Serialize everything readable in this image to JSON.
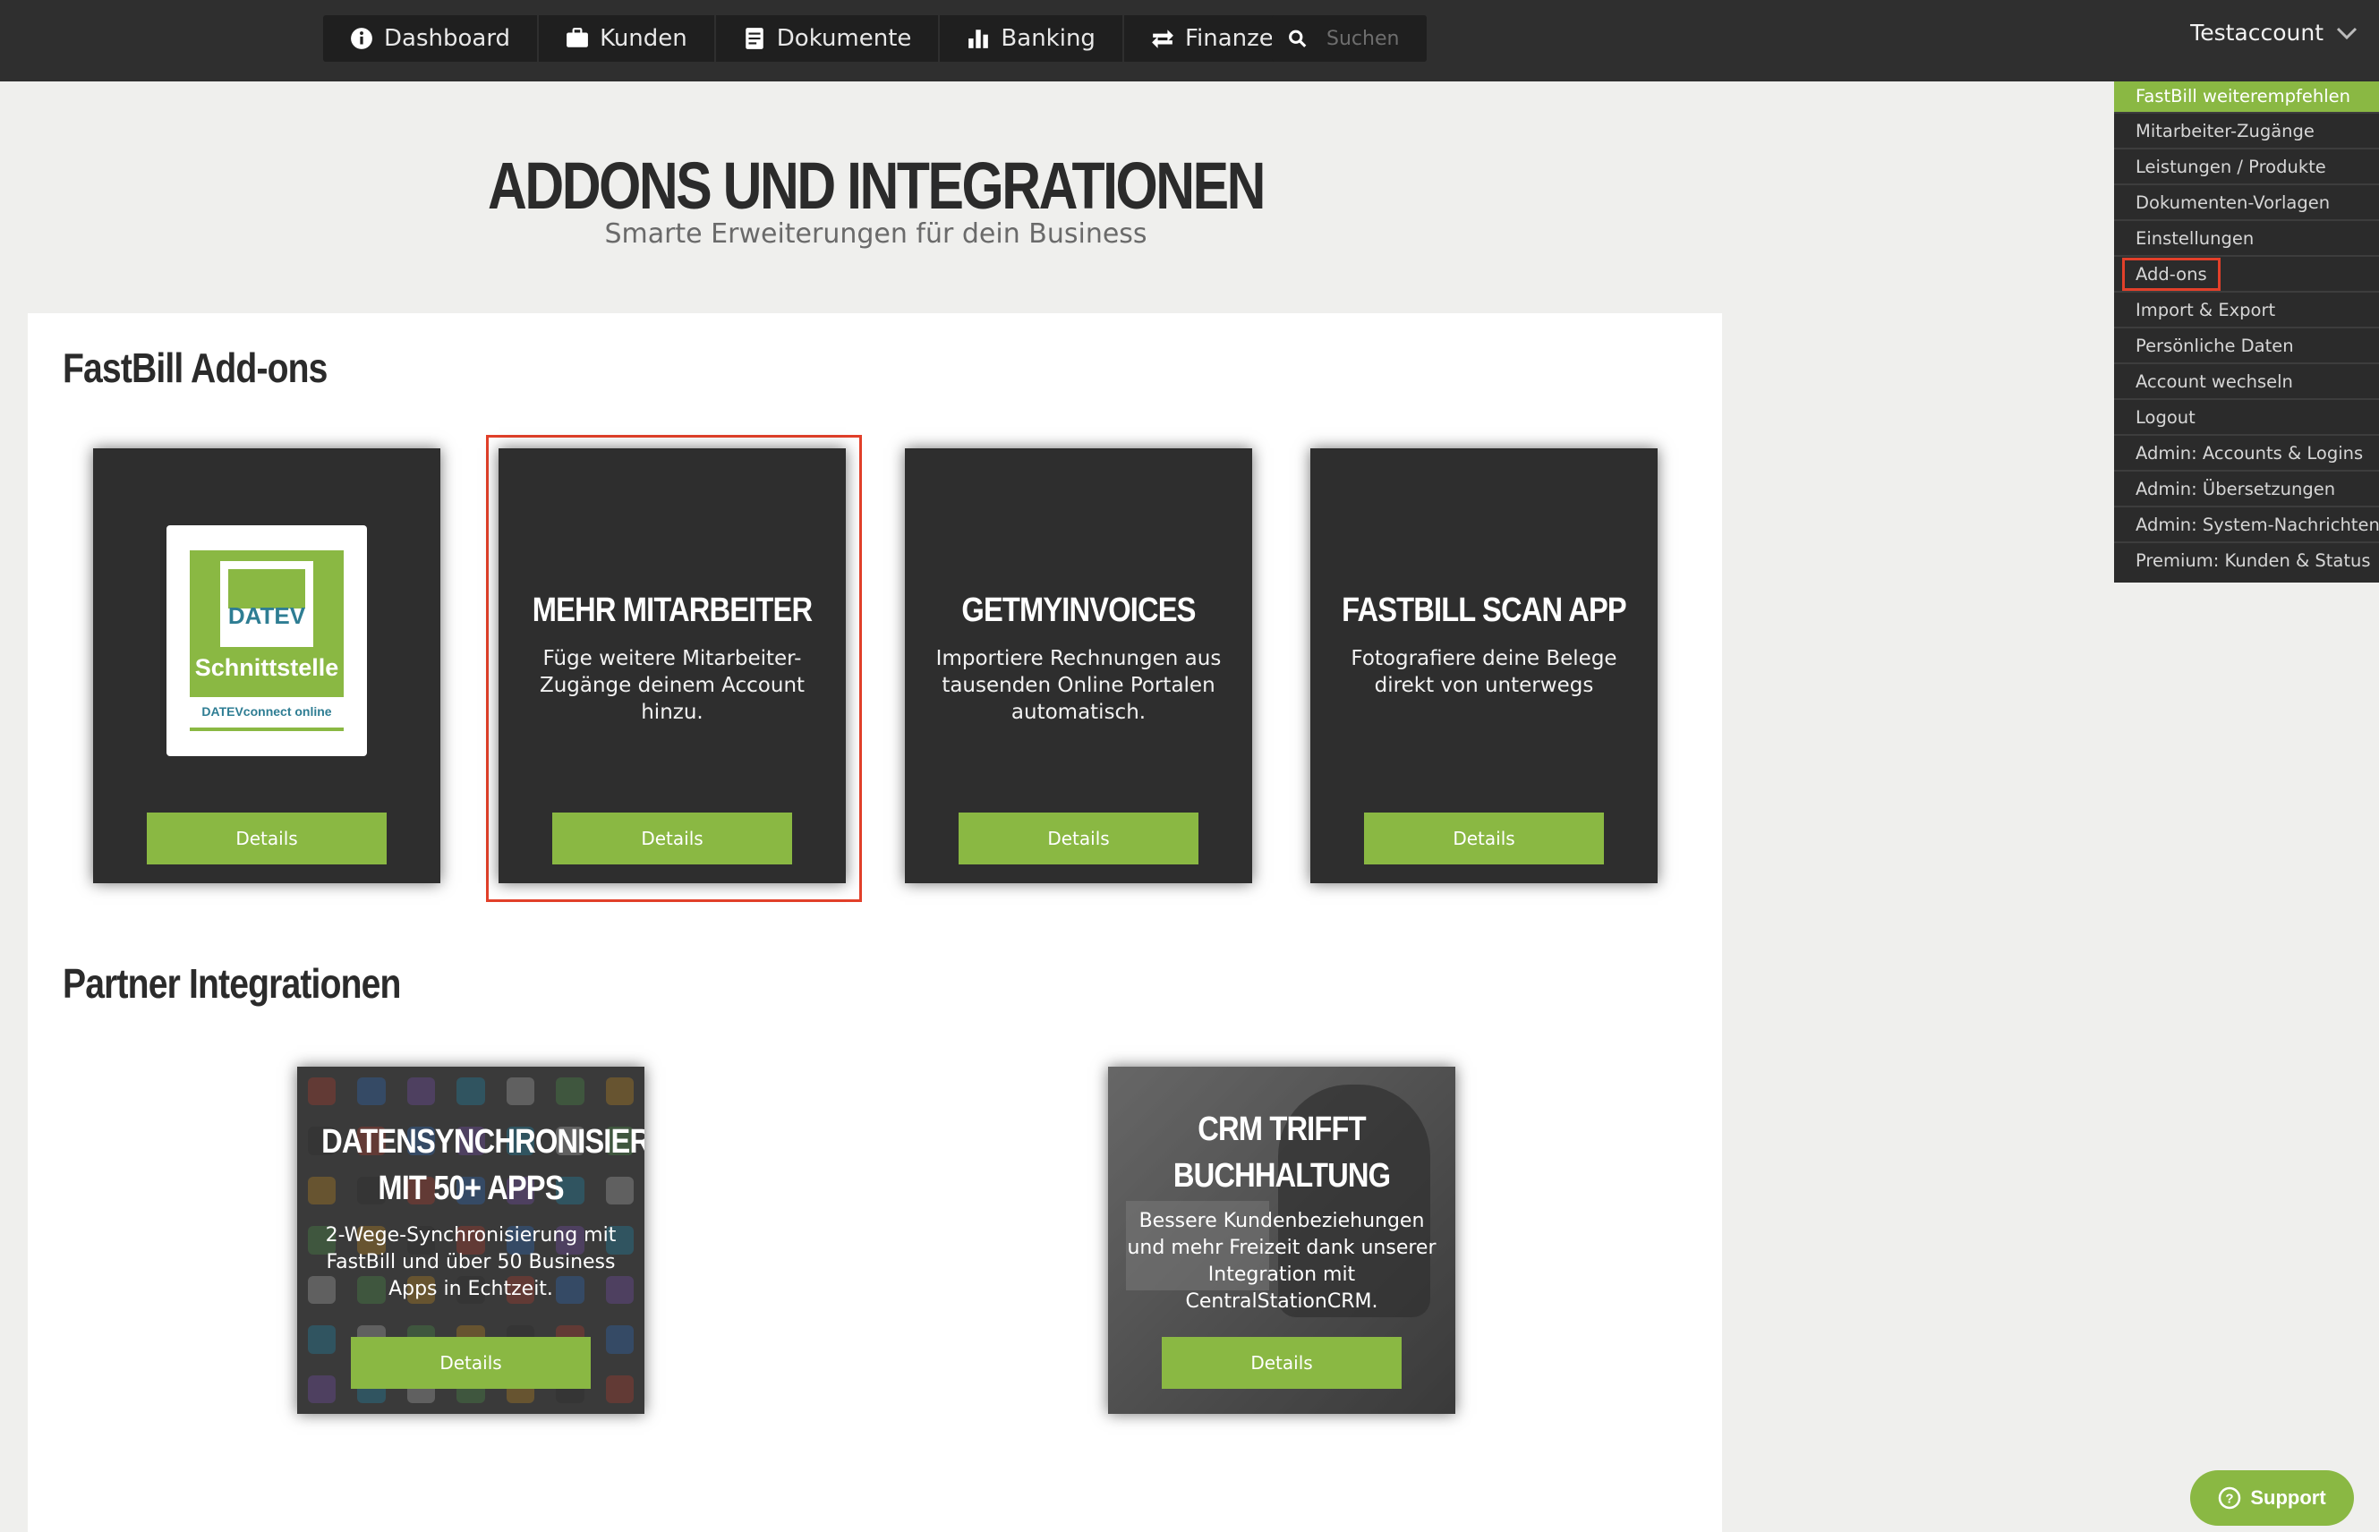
{
  "nav": {
    "items": [
      {
        "label": "Dashboard",
        "icon": "info-icon"
      },
      {
        "label": "Kunden",
        "icon": "briefcase-icon"
      },
      {
        "label": "Dokumente",
        "icon": "document-icon"
      },
      {
        "label": "Banking",
        "icon": "bar-chart-icon"
      },
      {
        "label": "Finanzen",
        "icon": "transfer-arrows-icon"
      }
    ],
    "search_placeholder": "Suchen",
    "account_label": "Testaccount"
  },
  "dropdown": {
    "items": [
      "FastBill weiterempfehlen",
      "Mitarbeiter-Zugänge",
      "Leistungen / Produkte",
      "Dokumenten-Vorlagen",
      "Einstellungen",
      "Add-ons",
      "Import & Export",
      "Persönliche Daten",
      "Account wechseln",
      "Logout",
      "Admin: Accounts & Logins",
      "Admin: Übersetzungen",
      "Admin: System-Nachrichten",
      "Premium: Kunden & Status"
    ]
  },
  "page": {
    "title": "ADDONS UND INTEGRATIONEN",
    "subtitle": "Smarte Erweiterungen für dein Business"
  },
  "addons": {
    "section_title": "FastBill Add-ons",
    "datev": {
      "name": "DATEV",
      "label": "Schnittstelle",
      "sub": "DATEVconnect online",
      "button": "Details"
    },
    "cards": [
      {
        "title": "MEHR MITARBEITER",
        "text": "Füge weitere Mitarbeiter-Zugänge deinem Account hinzu.",
        "button": "Details"
      },
      {
        "title": "GETMYINVOICES",
        "text": "Importiere Rechnungen aus tausenden Online Portalen automatisch.",
        "button": "Details"
      },
      {
        "title": "FASTBILL SCAN APP",
        "text": "Fotografiere deine Belege direkt von unterwegs",
        "button": "Details"
      }
    ]
  },
  "partners": {
    "section_title": "Partner Integrationen",
    "cards": [
      {
        "title_line1": "DATENSYNCHRONISIERUNG",
        "title_line2": "MIT 50+ APPS",
        "text": "2-Wege-Synchronisierung mit FastBill und über 50 Business Apps in Echtzeit.",
        "button": "Details"
      },
      {
        "title_line1": "CRM TRIFFT",
        "title_line2": "BUCHHALTUNG",
        "text": "Bessere Kundenbeziehungen und mehr Freizeit dank unserer Integration mit CentralStationCRM.",
        "button": "Details"
      }
    ]
  },
  "support": {
    "label": "Support"
  },
  "colors": {
    "accent": "#8ab843",
    "highlight": "#e2402a",
    "dark": "#2e2e2e"
  }
}
